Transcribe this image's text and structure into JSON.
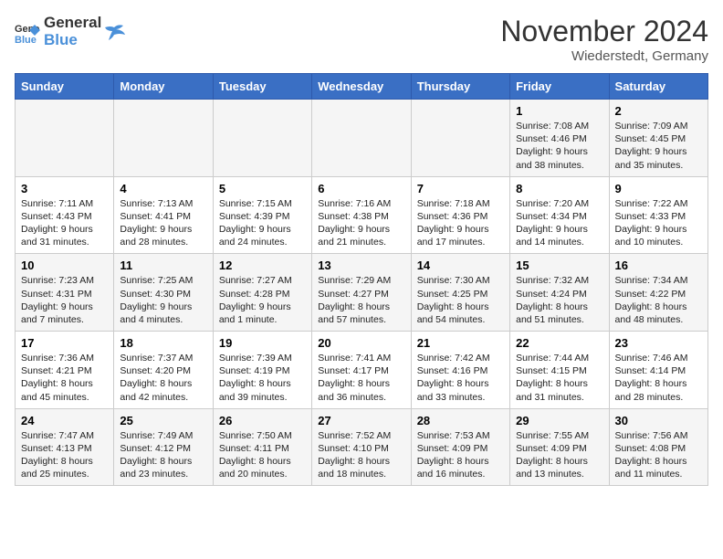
{
  "header": {
    "logo_general": "General",
    "logo_blue": "Blue",
    "month": "November 2024",
    "location": "Wiederstedt, Germany"
  },
  "weekdays": [
    "Sunday",
    "Monday",
    "Tuesday",
    "Wednesday",
    "Thursday",
    "Friday",
    "Saturday"
  ],
  "weeks": [
    [
      {
        "day": "",
        "info": ""
      },
      {
        "day": "",
        "info": ""
      },
      {
        "day": "",
        "info": ""
      },
      {
        "day": "",
        "info": ""
      },
      {
        "day": "",
        "info": ""
      },
      {
        "day": "1",
        "info": "Sunrise: 7:08 AM\nSunset: 4:46 PM\nDaylight: 9 hours and 38 minutes."
      },
      {
        "day": "2",
        "info": "Sunrise: 7:09 AM\nSunset: 4:45 PM\nDaylight: 9 hours and 35 minutes."
      }
    ],
    [
      {
        "day": "3",
        "info": "Sunrise: 7:11 AM\nSunset: 4:43 PM\nDaylight: 9 hours and 31 minutes."
      },
      {
        "day": "4",
        "info": "Sunrise: 7:13 AM\nSunset: 4:41 PM\nDaylight: 9 hours and 28 minutes."
      },
      {
        "day": "5",
        "info": "Sunrise: 7:15 AM\nSunset: 4:39 PM\nDaylight: 9 hours and 24 minutes."
      },
      {
        "day": "6",
        "info": "Sunrise: 7:16 AM\nSunset: 4:38 PM\nDaylight: 9 hours and 21 minutes."
      },
      {
        "day": "7",
        "info": "Sunrise: 7:18 AM\nSunset: 4:36 PM\nDaylight: 9 hours and 17 minutes."
      },
      {
        "day": "8",
        "info": "Sunrise: 7:20 AM\nSunset: 4:34 PM\nDaylight: 9 hours and 14 minutes."
      },
      {
        "day": "9",
        "info": "Sunrise: 7:22 AM\nSunset: 4:33 PM\nDaylight: 9 hours and 10 minutes."
      }
    ],
    [
      {
        "day": "10",
        "info": "Sunrise: 7:23 AM\nSunset: 4:31 PM\nDaylight: 9 hours and 7 minutes."
      },
      {
        "day": "11",
        "info": "Sunrise: 7:25 AM\nSunset: 4:30 PM\nDaylight: 9 hours and 4 minutes."
      },
      {
        "day": "12",
        "info": "Sunrise: 7:27 AM\nSunset: 4:28 PM\nDaylight: 9 hours and 1 minute."
      },
      {
        "day": "13",
        "info": "Sunrise: 7:29 AM\nSunset: 4:27 PM\nDaylight: 8 hours and 57 minutes."
      },
      {
        "day": "14",
        "info": "Sunrise: 7:30 AM\nSunset: 4:25 PM\nDaylight: 8 hours and 54 minutes."
      },
      {
        "day": "15",
        "info": "Sunrise: 7:32 AM\nSunset: 4:24 PM\nDaylight: 8 hours and 51 minutes."
      },
      {
        "day": "16",
        "info": "Sunrise: 7:34 AM\nSunset: 4:22 PM\nDaylight: 8 hours and 48 minutes."
      }
    ],
    [
      {
        "day": "17",
        "info": "Sunrise: 7:36 AM\nSunset: 4:21 PM\nDaylight: 8 hours and 45 minutes."
      },
      {
        "day": "18",
        "info": "Sunrise: 7:37 AM\nSunset: 4:20 PM\nDaylight: 8 hours and 42 minutes."
      },
      {
        "day": "19",
        "info": "Sunrise: 7:39 AM\nSunset: 4:19 PM\nDaylight: 8 hours and 39 minutes."
      },
      {
        "day": "20",
        "info": "Sunrise: 7:41 AM\nSunset: 4:17 PM\nDaylight: 8 hours and 36 minutes."
      },
      {
        "day": "21",
        "info": "Sunrise: 7:42 AM\nSunset: 4:16 PM\nDaylight: 8 hours and 33 minutes."
      },
      {
        "day": "22",
        "info": "Sunrise: 7:44 AM\nSunset: 4:15 PM\nDaylight: 8 hours and 31 minutes."
      },
      {
        "day": "23",
        "info": "Sunrise: 7:46 AM\nSunset: 4:14 PM\nDaylight: 8 hours and 28 minutes."
      }
    ],
    [
      {
        "day": "24",
        "info": "Sunrise: 7:47 AM\nSunset: 4:13 PM\nDaylight: 8 hours and 25 minutes."
      },
      {
        "day": "25",
        "info": "Sunrise: 7:49 AM\nSunset: 4:12 PM\nDaylight: 8 hours and 23 minutes."
      },
      {
        "day": "26",
        "info": "Sunrise: 7:50 AM\nSunset: 4:11 PM\nDaylight: 8 hours and 20 minutes."
      },
      {
        "day": "27",
        "info": "Sunrise: 7:52 AM\nSunset: 4:10 PM\nDaylight: 8 hours and 18 minutes."
      },
      {
        "day": "28",
        "info": "Sunrise: 7:53 AM\nSunset: 4:09 PM\nDaylight: 8 hours and 16 minutes."
      },
      {
        "day": "29",
        "info": "Sunrise: 7:55 AM\nSunset: 4:09 PM\nDaylight: 8 hours and 13 minutes."
      },
      {
        "day": "30",
        "info": "Sunrise: 7:56 AM\nSunset: 4:08 PM\nDaylight: 8 hours and 11 minutes."
      }
    ]
  ]
}
